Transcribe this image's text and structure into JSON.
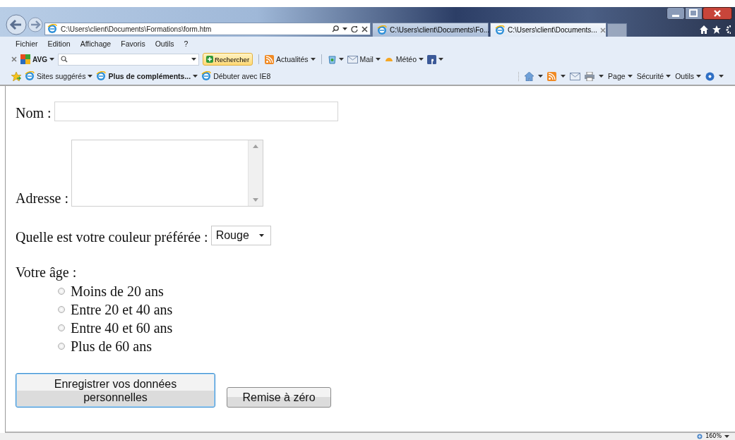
{
  "browser": {
    "address": "C:\\Users\\client\\Documents\\Formations\\form.htm",
    "tabs": [
      {
        "label": "C:\\Users\\client\\Documents\\Fo...",
        "selected": false
      },
      {
        "label": "C:\\Users\\client\\Documents...",
        "selected": true
      }
    ],
    "menu": [
      "Fichier",
      "Edition",
      "Affichage",
      "Favoris",
      "Outils",
      "?"
    ],
    "toolbar": {
      "brand": "AVG",
      "search_button": "Rechercher",
      "items": [
        {
          "kind": "rss",
          "label": "Actualités"
        },
        {
          "kind": "recycle"
        },
        {
          "kind": "mail",
          "label": "Mail"
        },
        {
          "kind": "weather",
          "label": "Météo"
        },
        {
          "kind": "social"
        }
      ]
    },
    "favorites": [
      {
        "label": "Sites suggérés",
        "bold": false,
        "caret": true
      },
      {
        "label": "Plus de compléments...",
        "bold": true,
        "caret": true
      },
      {
        "label": "Débuter avec IE8",
        "bold": false,
        "caret": false
      }
    ],
    "command_bar": [
      "Page",
      "Sécurité",
      "Outils"
    ]
  },
  "form": {
    "name_label": "Nom :",
    "address_label": "Adresse :",
    "color_label": "Quelle est votre couleur préférée :",
    "color_value": "Rouge",
    "age_label": "Votre âge :",
    "age_options": [
      {
        "label": "Moins de 20 ans",
        "selected": false
      },
      {
        "label": "Entre 20 et 40 ans",
        "selected": false
      },
      {
        "label": "Entre 40 et 60 ans",
        "selected": false
      },
      {
        "label": "Plus de 60 ans",
        "selected": false
      }
    ],
    "buttons": [
      {
        "label": "Enregistrer vos données personnelles",
        "focused": true
      },
      {
        "label": "Remise à zéro",
        "focused": false
      }
    ]
  },
  "status_bar": {
    "zoom": "160%"
  }
}
